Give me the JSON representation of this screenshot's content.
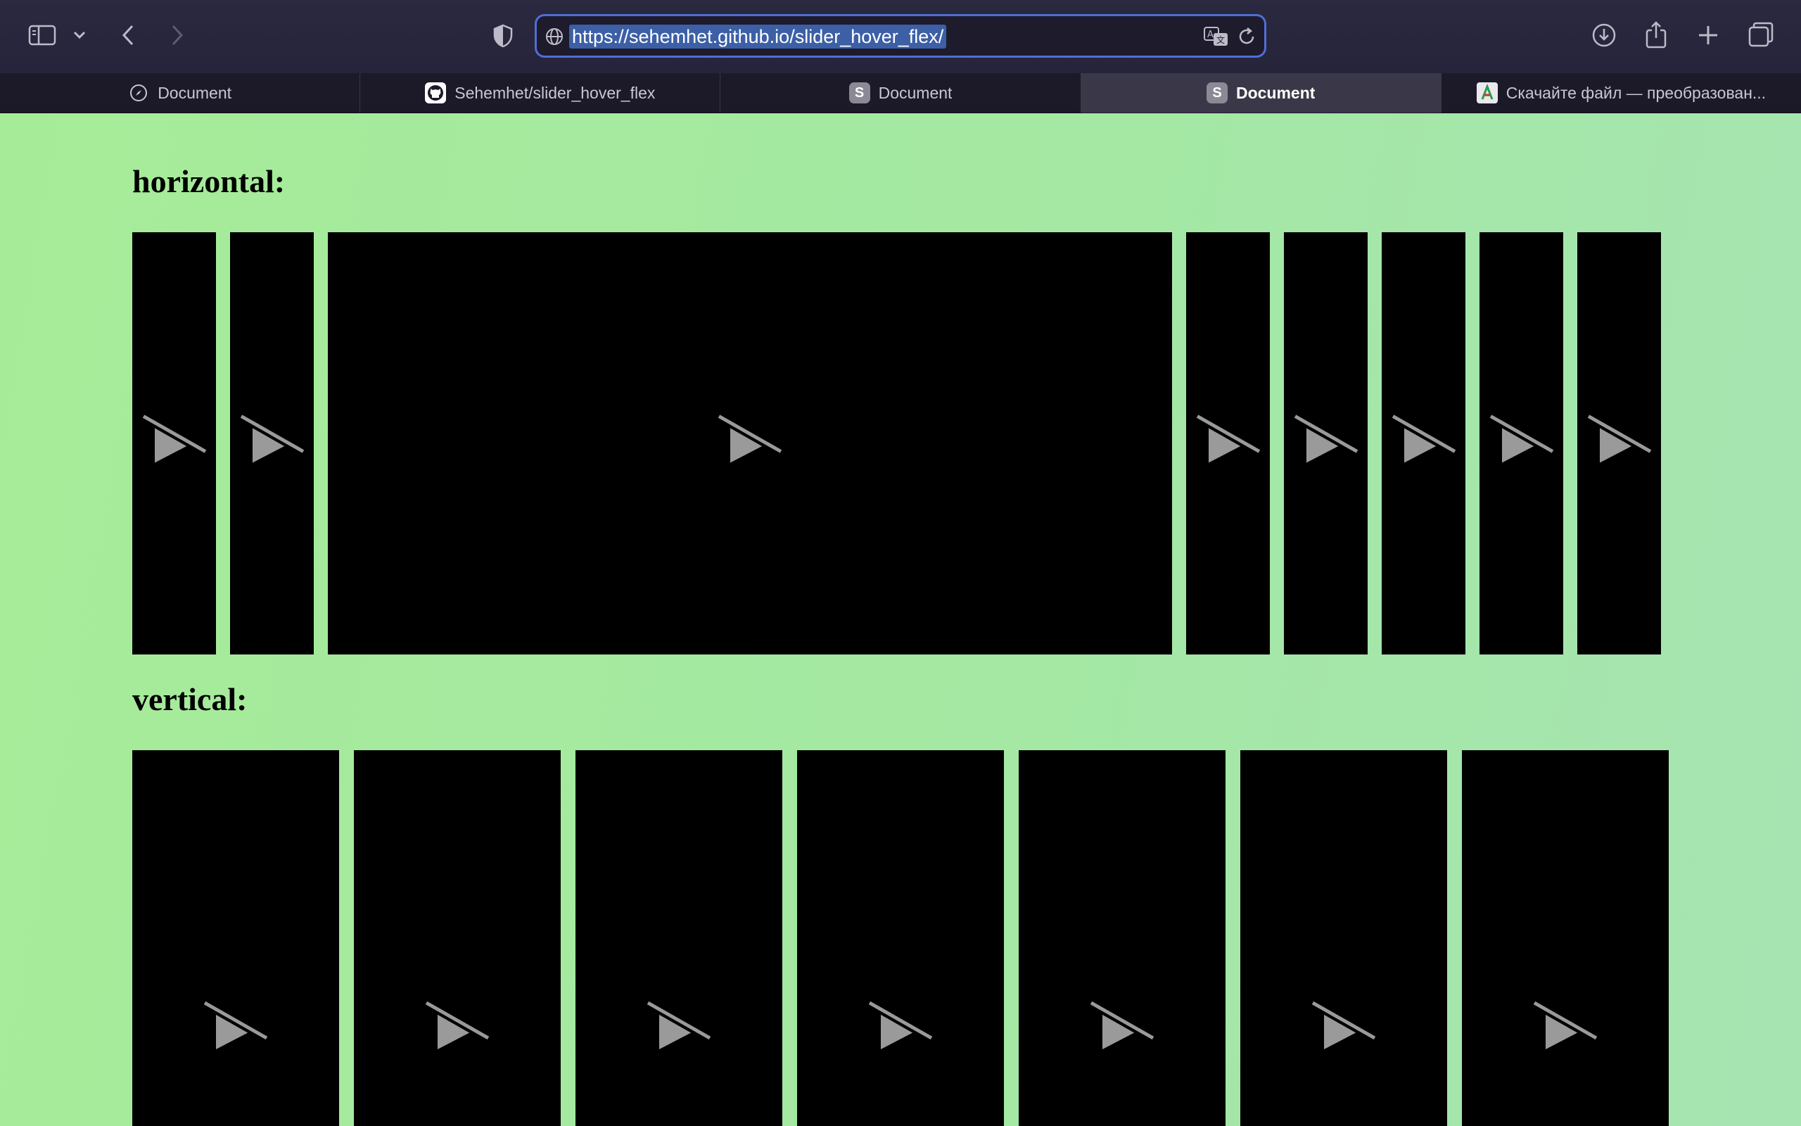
{
  "browser": {
    "url": "https://sehemhet.github.io/slider_hover_flex/",
    "tabs": [
      {
        "label": "Document",
        "icon": "compass-icon",
        "active": false
      },
      {
        "label": "Sehemhet/slider_hover_flex",
        "icon": "github-icon",
        "active": false
      },
      {
        "label": "Document",
        "icon": "s-icon",
        "active": false
      },
      {
        "label": "Document",
        "icon": "s-icon",
        "active": true
      },
      {
        "label": "Скачайте файл — преобразован...",
        "icon": "download-site-icon",
        "active": false
      }
    ]
  },
  "page": {
    "horizontal_title": "horizontal:",
    "vertical_title": "vertical:",
    "horizontal_videos": 8,
    "horizontal_expanded_index": 2,
    "vertical_videos": 7
  },
  "colors": {
    "page_bg": "#a6ec98",
    "url_highlight": "#3c5fa6",
    "url_border": "#4f6fd6",
    "video_bg": "#000000",
    "play_icon": "#9a9a9a"
  }
}
